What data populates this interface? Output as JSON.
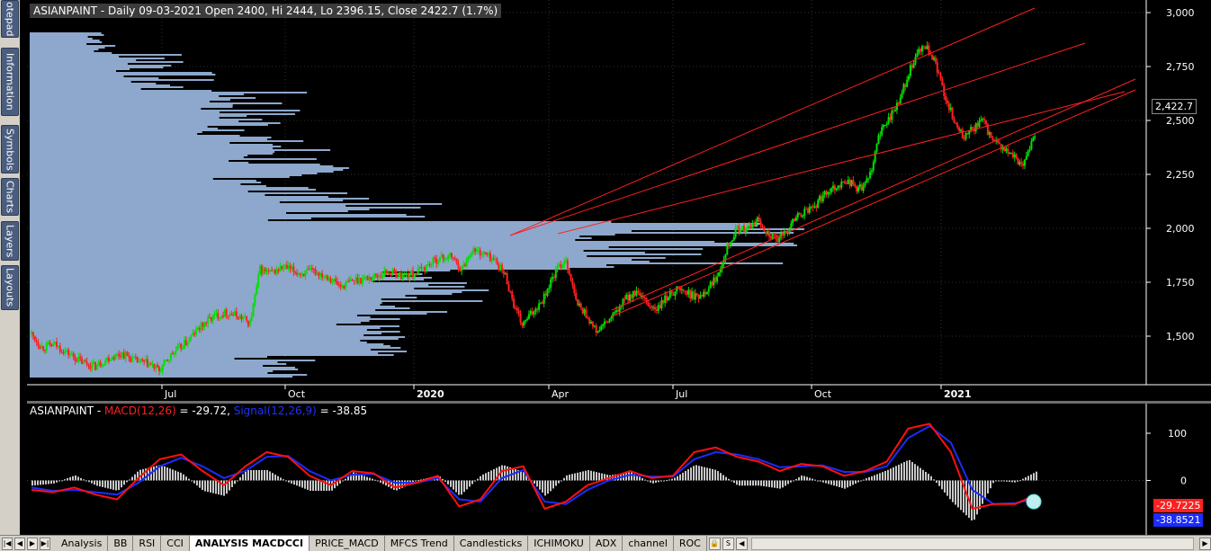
{
  "side_tabs": [
    {
      "label": "otepad",
      "top": 0,
      "height": 42
    },
    {
      "label": "Information",
      "top": 53,
      "height": 76
    },
    {
      "label": "Symbols",
      "top": 139,
      "height": 54
    },
    {
      "label": "Charts",
      "top": 198,
      "height": 42
    },
    {
      "label": "Layers",
      "top": 246,
      "height": 44
    },
    {
      "label": "Layouts",
      "top": 295,
      "height": 50
    }
  ],
  "price_header": "ASIANPAINT - Daily 09-03-2021 Open 2400, Hi 2444, Lo 2396.15, Close 2422.7 (1.7%)",
  "macd_header": {
    "prefix": "ASIANPAINT - ",
    "macd_label": "MACD(12,26)",
    "macd_value": " = -29.72, ",
    "signal_label": "Signal(12,26,9)",
    "signal_value": " = -38.85"
  },
  "price_last_box": "2,422.7",
  "macd_last_box": "-29.7225",
  "signal_last_box": "-38.8521",
  "colors": {
    "up": "#00e000",
    "down": "#ff2020",
    "profile": "#8da8cc",
    "macd": "#ff1010",
    "signal": "#1c2cff",
    "channel": "#ff2020",
    "hist": "#c8c8c8"
  },
  "tabs": [
    "Analysis",
    "BB",
    "RSI",
    "CCI",
    "ANALYSIS MACDCCI",
    "PRICE_MACD",
    "MFCS Trend",
    "Candlesticks",
    "ICHIMOKU",
    "ADX",
    "channel",
    "ROC"
  ],
  "active_tab": "ANALYSIS MACDCCI",
  "chart_data": [
    {
      "type": "candlestick",
      "title": "ASIANPAINT - Daily 09-03-2021 Open 2400, Hi 2444, Lo 2396.15, Close 2422.7 (1.7%)",
      "ylim": [
        1300,
        3000
      ],
      "yticks": [
        1500,
        1750,
        2000,
        2250,
        2500,
        2750,
        3000
      ],
      "ytick_labels": [
        "1,500",
        "1,750",
        "2,000",
        "2,250",
        "2,500",
        "2,750",
        "3,000"
      ],
      "xticks": [
        "Jul",
        "Oct",
        "2020",
        "Apr",
        "Jul",
        "Oct",
        "2021"
      ],
      "last": {
        "open": 2400,
        "high": 2444,
        "low": 2396.15,
        "close": 2422.7,
        "change_pct": 1.7
      },
      "path": [
        [
          0,
          1510
        ],
        [
          6,
          1450
        ],
        [
          14,
          1460
        ],
        [
          22,
          1420
        ],
        [
          30,
          1380
        ],
        [
          38,
          1360
        ],
        [
          46,
          1400
        ],
        [
          54,
          1420
        ],
        [
          62,
          1385
        ],
        [
          70,
          1370
        ],
        [
          76,
          1340
        ],
        [
          84,
          1420
        ],
        [
          92,
          1470
        ],
        [
          100,
          1540
        ],
        [
          108,
          1590
        ],
        [
          116,
          1610
        ],
        [
          124,
          1590
        ],
        [
          130,
          1560
        ],
        [
          136,
          1810
        ],
        [
          142,
          1790
        ],
        [
          150,
          1820
        ],
        [
          160,
          1790
        ],
        [
          168,
          1800
        ],
        [
          176,
          1780
        ],
        [
          184,
          1730
        ],
        [
          192,
          1760
        ],
        [
          200,
          1770
        ],
        [
          206,
          1780
        ],
        [
          212,
          1800
        ],
        [
          220,
          1780
        ],
        [
          228,
          1790
        ],
        [
          234,
          1820
        ],
        [
          242,
          1860
        ],
        [
          250,
          1870
        ],
        [
          256,
          1810
        ],
        [
          262,
          1900
        ],
        [
          270,
          1880
        ],
        [
          276,
          1850
        ],
        [
          282,
          1780
        ],
        [
          288,
          1620
        ],
        [
          292,
          1550
        ],
        [
          298,
          1610
        ],
        [
          304,
          1670
        ],
        [
          312,
          1800
        ],
        [
          318,
          1860
        ],
        [
          324,
          1660
        ],
        [
          330,
          1600
        ],
        [
          336,
          1520
        ],
        [
          342,
          1560
        ],
        [
          348,
          1610
        ],
        [
          354,
          1680
        ],
        [
          360,
          1700
        ],
        [
          366,
          1650
        ],
        [
          372,
          1620
        ],
        [
          378,
          1680
        ],
        [
          384,
          1720
        ],
        [
          390,
          1700
        ],
        [
          396,
          1680
        ],
        [
          402,
          1720
        ],
        [
          408,
          1780
        ],
        [
          414,
          1920
        ],
        [
          420,
          2000
        ],
        [
          426,
          1990
        ],
        [
          432,
          2040
        ],
        [
          438,
          1980
        ],
        [
          444,
          1940
        ],
        [
          450,
          2000
        ],
        [
          456,
          2060
        ],
        [
          462,
          2080
        ],
        [
          468,
          2120
        ],
        [
          474,
          2180
        ],
        [
          480,
          2200
        ],
        [
          486,
          2220
        ],
        [
          492,
          2180
        ],
        [
          498,
          2220
        ],
        [
          504,
          2420
        ],
        [
          510,
          2510
        ],
        [
          516,
          2580
        ],
        [
          522,
          2720
        ],
        [
          528,
          2820
        ],
        [
          532,
          2840
        ],
        [
          538,
          2760
        ],
        [
          542,
          2650
        ],
        [
          548,
          2520
        ],
        [
          554,
          2420
        ],
        [
          560,
          2460
        ],
        [
          566,
          2500
        ],
        [
          572,
          2400
        ],
        [
          578,
          2370
        ],
        [
          584,
          2330
        ],
        [
          590,
          2300
        ],
        [
          594,
          2380
        ],
        [
          598,
          2422
        ]
      ]
    },
    {
      "type": "line",
      "title": "ASIANPAINT - MACD(12,26) = -29.72, Signal(12,26,9) = -38.85",
      "ylim": [
        -100,
        140
      ],
      "yticks": [
        0,
        100
      ],
      "ytick_labels": [
        "0",
        "100"
      ],
      "series": [
        {
          "name": "MACD(12,26)",
          "values": [
            -20,
            -25,
            -15,
            -30,
            -40,
            5,
            45,
            55,
            20,
            -10,
            30,
            60,
            50,
            10,
            -10,
            20,
            15,
            -15,
            -5,
            10,
            -55,
            -40,
            20,
            30,
            -60,
            -45,
            -10,
            5,
            20,
            5,
            10,
            60,
            70,
            50,
            40,
            20,
            35,
            30,
            10,
            20,
            40,
            110,
            120,
            60,
            -60,
            -50,
            -50,
            -30
          ]
        },
        {
          "name": "Signal(12,26,9)",
          "values": [
            -15,
            -22,
            -20,
            -25,
            -30,
            -5,
            30,
            48,
            30,
            5,
            20,
            50,
            52,
            20,
            0,
            12,
            14,
            -5,
            -5,
            5,
            -40,
            -45,
            5,
            22,
            -45,
            -50,
            -20,
            0,
            12,
            8,
            8,
            45,
            60,
            55,
            45,
            28,
            30,
            32,
            18,
            18,
            30,
            90,
            115,
            80,
            -20,
            -50,
            -48,
            -39
          ]
        }
      ]
    }
  ]
}
